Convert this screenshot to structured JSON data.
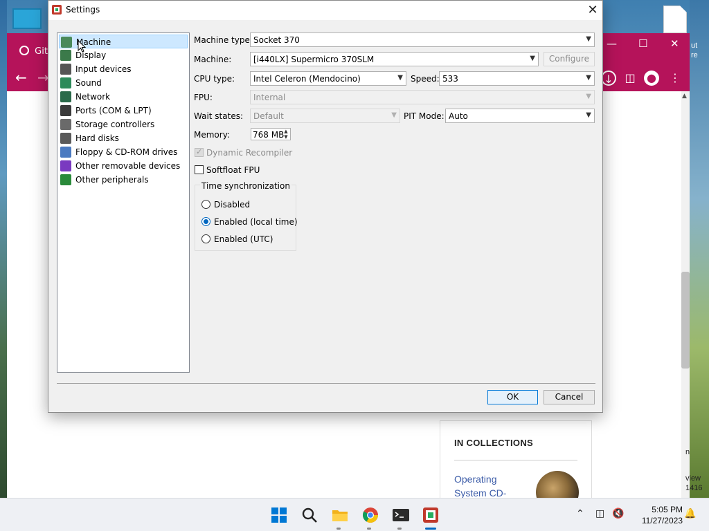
{
  "browser": {
    "tab_label": "Git",
    "page_partial_right": [
      "n",
      "view",
      "1416"
    ],
    "page_partial_top_right": [
      "ut",
      "re"
    ],
    "in_collections": {
      "title": "IN COLLECTIONS",
      "link": "Operating System CD-"
    }
  },
  "dialog": {
    "title": "Settings",
    "tree": [
      {
        "label": "Machine",
        "icon": "machine-icon",
        "color": "#4a8a5a",
        "selected": true
      },
      {
        "label": "Display",
        "icon": "display-icon",
        "color": "#3b7a4a"
      },
      {
        "label": "Input devices",
        "icon": "input-devices-icon",
        "color": "#555555"
      },
      {
        "label": "Sound",
        "icon": "sound-icon",
        "color": "#2d8a5a"
      },
      {
        "label": "Network",
        "icon": "network-icon",
        "color": "#2a6a4a"
      },
      {
        "label": "Ports (COM & LPT)",
        "icon": "ports-icon",
        "color": "#3a3a3a"
      },
      {
        "label": "Storage controllers",
        "icon": "storage-controllers-icon",
        "color": "#6a6a6a"
      },
      {
        "label": "Hard disks",
        "icon": "hard-disks-icon",
        "color": "#5a5a5a"
      },
      {
        "label": "Floppy & CD-ROM drives",
        "icon": "floppy-cdrom-icon",
        "color": "#4a7ac0"
      },
      {
        "label": "Other removable devices",
        "icon": "removable-devices-icon",
        "color": "#7a3ac0"
      },
      {
        "label": "Other peripherals",
        "icon": "peripherals-icon",
        "color": "#2a8a3a"
      }
    ],
    "machine_type": {
      "label": "Machine type:",
      "value": "Socket 370"
    },
    "machine": {
      "label": "Machine:",
      "value": "[i440LX] Supermicro 370SLM",
      "configure": "Configure"
    },
    "cpu_type": {
      "label": "CPU type:",
      "value": "Intel Celeron (Mendocino)"
    },
    "speed": {
      "label": "Speed:",
      "value": "533"
    },
    "fpu": {
      "label": "FPU:",
      "value": "Internal"
    },
    "wait_states": {
      "label": "Wait states:",
      "value": "Default"
    },
    "pit_mode": {
      "label": "PIT Mode:",
      "value": "Auto"
    },
    "memory": {
      "label": "Memory:",
      "value": "768 MB"
    },
    "dynamic_recompiler": {
      "label": "Dynamic Recompiler",
      "checked": true,
      "disabled": true
    },
    "softfloat_fpu": {
      "label": "Softfloat FPU",
      "checked": false
    },
    "time_sync": {
      "title": "Time synchronization",
      "options": [
        {
          "label": "Disabled",
          "selected": false
        },
        {
          "label": "Enabled (local time)",
          "selected": true
        },
        {
          "label": "Enabled (UTC)",
          "selected": false
        }
      ]
    },
    "ok": "OK",
    "cancel": "Cancel"
  },
  "taskbar": {
    "time": "5:05 PM",
    "date": "11/27/2023",
    "apps": [
      "start-icon",
      "search-icon",
      "file-explorer-icon",
      "chrome-icon",
      "terminal-icon",
      "86box-icon"
    ],
    "accent": "#0067c0"
  }
}
